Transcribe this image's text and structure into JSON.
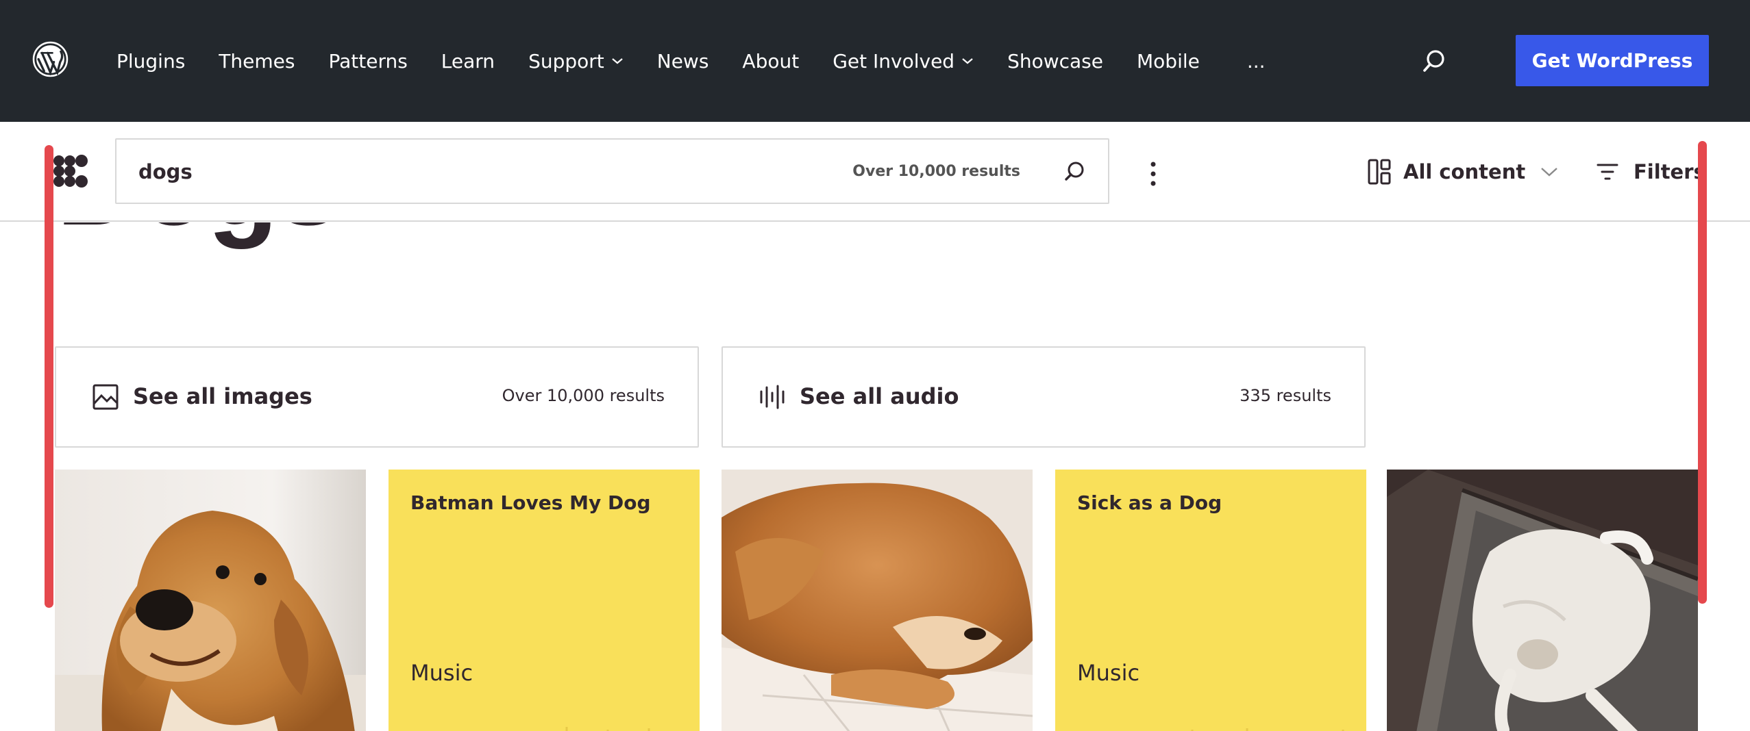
{
  "wpbar": {
    "nav": [
      {
        "label": "Plugins",
        "dropdown": false
      },
      {
        "label": "Themes",
        "dropdown": false
      },
      {
        "label": "Patterns",
        "dropdown": false
      },
      {
        "label": "Learn",
        "dropdown": false
      },
      {
        "label": "Support",
        "dropdown": true
      },
      {
        "label": "News",
        "dropdown": false
      },
      {
        "label": "About",
        "dropdown": false
      },
      {
        "label": "Get Involved",
        "dropdown": true
      },
      {
        "label": "Showcase",
        "dropdown": false
      },
      {
        "label": "Mobile",
        "dropdown": false
      }
    ],
    "more_label": "...",
    "cta_label": "Get WordPress",
    "colors": {
      "bar": "#23282d",
      "cta": "#3858e9"
    }
  },
  "header": {
    "search_value": "dogs",
    "result_count": "Over 10,000 results",
    "content_type_label": "All content",
    "filters_label": "Filters"
  },
  "main": {
    "title": "Dogs",
    "see_all": [
      {
        "label": "See all images",
        "count": "Over 10,000 results",
        "icon": "image-icon"
      },
      {
        "label": "See all audio",
        "count": "335 results",
        "icon": "audio-icon"
      }
    ],
    "results": [
      {
        "type": "image",
        "description": "golden retriever sitting"
      },
      {
        "type": "audio",
        "title": "Batman Loves My Dog",
        "genre": "Music"
      },
      {
        "type": "image",
        "description": "golden retriever lying down"
      },
      {
        "type": "audio",
        "title": "Sick as a Dog",
        "genre": "Music"
      },
      {
        "type": "image",
        "description": "white dog sleeping on mat"
      }
    ],
    "colors": {
      "audio_card": "#f9e05a",
      "focus_rail": "#e5484d"
    }
  }
}
